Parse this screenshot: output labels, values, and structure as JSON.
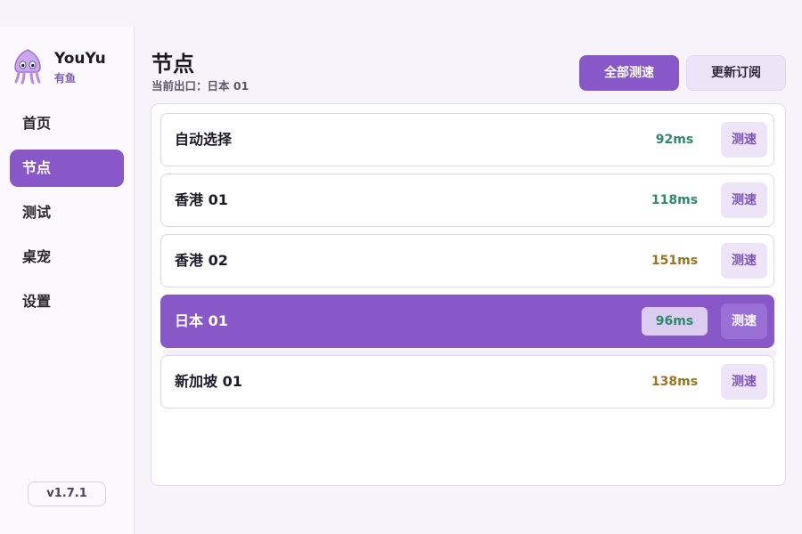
{
  "app": {
    "name": "YouYu",
    "subtitle": "有鱼",
    "version": "v1.7.1"
  },
  "sidebar": {
    "items": [
      {
        "label": "首页",
        "active": false
      },
      {
        "label": "节点",
        "active": true
      },
      {
        "label": "测试",
        "active": false
      },
      {
        "label": "桌宠",
        "active": false
      },
      {
        "label": "设置",
        "active": false
      }
    ]
  },
  "header": {
    "title": "节点",
    "exit_label": "当前出口：日本 01",
    "test_all_label": "全部测速",
    "update_sub_label": "更新订阅"
  },
  "nodes": [
    {
      "name": "自动选择",
      "latency": "92ms",
      "status": "good",
      "button": "测速",
      "selected": false
    },
    {
      "name": "香港 01",
      "latency": "118ms",
      "status": "good",
      "button": "测速",
      "selected": false
    },
    {
      "name": "香港 02",
      "latency": "151ms",
      "status": "mid",
      "button": "测速",
      "selected": false
    },
    {
      "name": "日本 01",
      "latency": "96ms",
      "status": "good",
      "button": "测速",
      "selected": true
    },
    {
      "name": "新加坡 01",
      "latency": "138ms",
      "status": "mid",
      "button": "测速",
      "selected": false
    }
  ],
  "colors": {
    "accent": "#8858c8",
    "latency_good": "#2e8a6a",
    "latency_mid": "#9a7520",
    "button_soft": "#ede4f8"
  },
  "icons": {
    "logo": "squid-logo-icon"
  }
}
